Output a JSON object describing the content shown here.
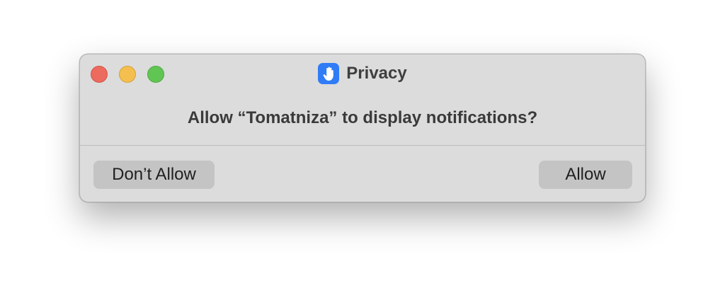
{
  "window": {
    "title": "Privacy",
    "icon": "raised-hand-icon",
    "accent_color": "#2f7cf6"
  },
  "traffic_lights": {
    "close_color": "#ec6a5e",
    "minimize_color": "#f4bf4f",
    "zoom_color": "#61c554"
  },
  "dialog": {
    "message": "Allow “Tomatniza” to display notifications?"
  },
  "buttons": {
    "deny_label": "Don’t Allow",
    "allow_label": "Allow"
  }
}
